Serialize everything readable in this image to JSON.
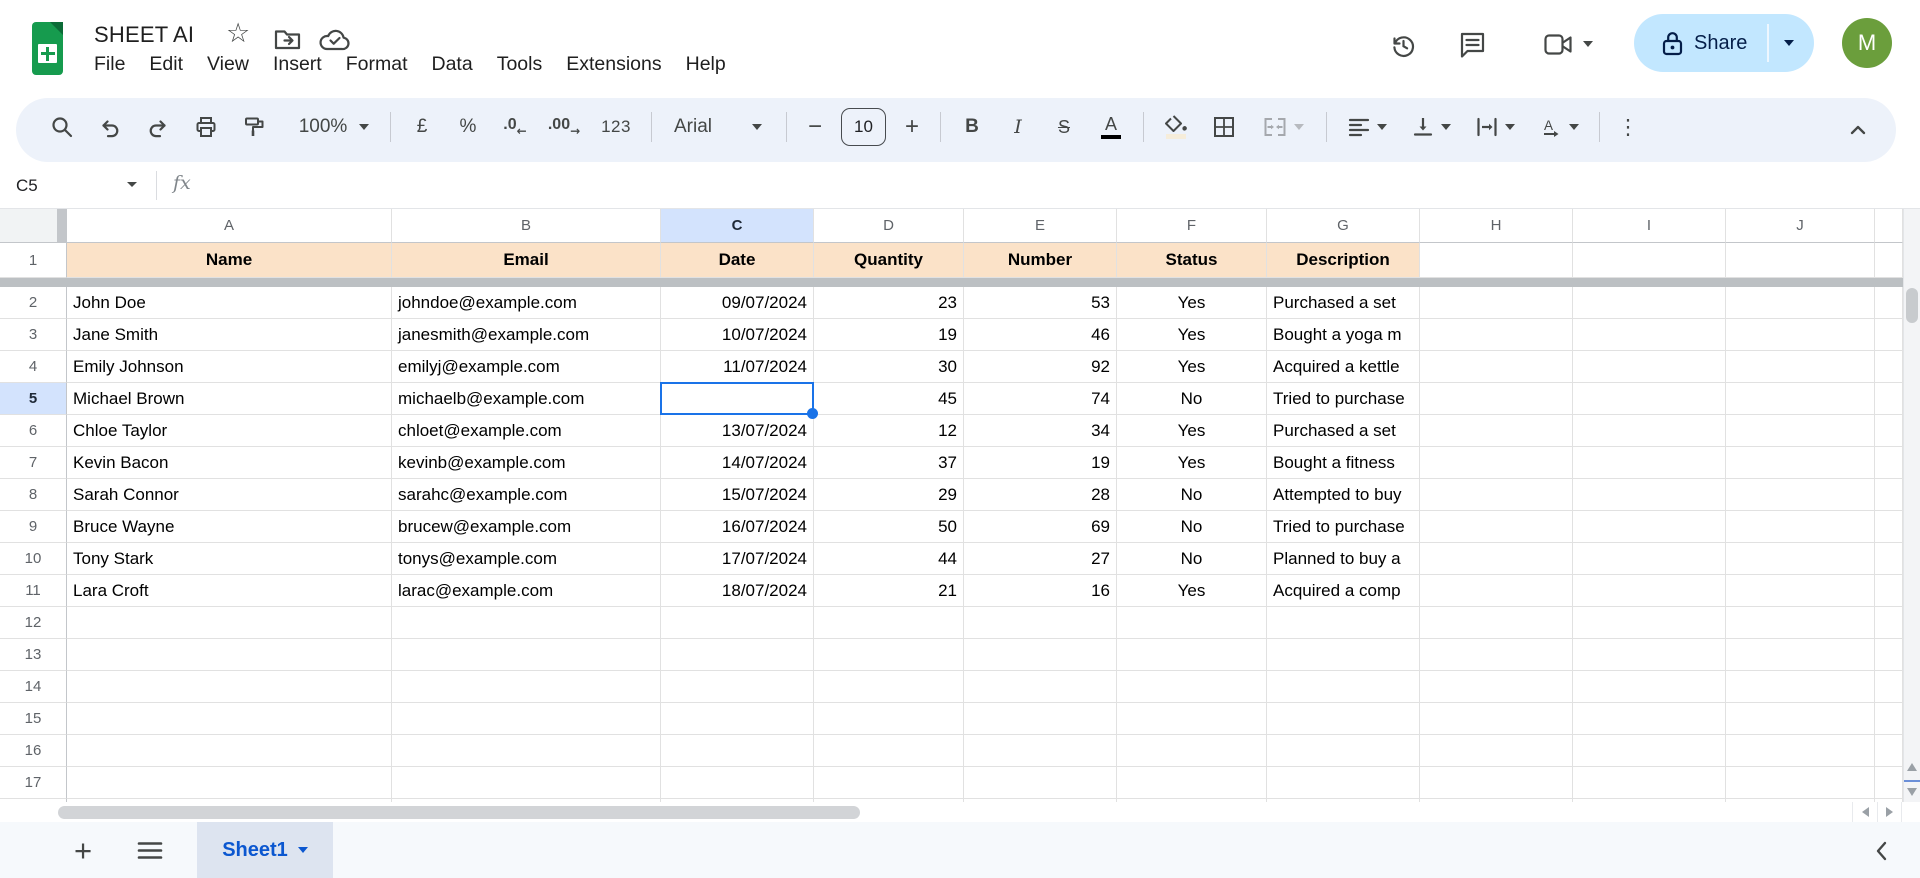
{
  "header": {
    "title": "SHEET AI",
    "menu_items": [
      "File",
      "Edit",
      "View",
      "Insert",
      "Format",
      "Data",
      "Tools",
      "Extensions",
      "Help"
    ],
    "share_label": "Share",
    "avatar_initial": "M"
  },
  "toolbar": {
    "zoom": "100%",
    "currency": "£",
    "percent": "%",
    "decimal_decrease": ".0",
    "decimal_increase": ".00",
    "format_123": "123",
    "font_family": "Arial",
    "font_size": "10",
    "bold": "B",
    "italic": "I",
    "strikethrough": "S",
    "text_color": "A",
    "more": "⋮"
  },
  "formula_bar": {
    "cell_reference": "C5",
    "fx": "fx"
  },
  "grid": {
    "column_letters": [
      "A",
      "B",
      "C",
      "D",
      "E",
      "F",
      "G",
      "H",
      "I",
      "J"
    ],
    "selected_column": "C",
    "selected_cell": "C5",
    "selected_row_number": 5,
    "header_row": [
      "Name",
      "Email",
      "Date",
      "Quantity",
      "Number",
      "Status",
      "Description"
    ],
    "rows": [
      {
        "n": 2,
        "name": "John Doe",
        "email": "johndoe@example.com",
        "date": "09/07/2024",
        "quantity": "23",
        "number": "53",
        "status": "Yes",
        "description": "Purchased a set"
      },
      {
        "n": 3,
        "name": "Jane Smith",
        "email": "janesmith@example.com",
        "date": "10/07/2024",
        "quantity": "19",
        "number": "46",
        "status": "Yes",
        "description": "Bought a yoga m"
      },
      {
        "n": 4,
        "name": "Emily Johnson",
        "email": "emilyj@example.com",
        "date": "11/07/2024",
        "quantity": "30",
        "number": "92",
        "status": "Yes",
        "description": "Acquired a kettle"
      },
      {
        "n": 5,
        "name": "Michael Brown",
        "email": "michaelb@example.com",
        "date": "",
        "quantity": "45",
        "number": "74",
        "status": "No",
        "description": "Tried to purchase"
      },
      {
        "n": 6,
        "name": "Chloe Taylor",
        "email": "chloet@example.com",
        "date": "13/07/2024",
        "quantity": "12",
        "number": "34",
        "status": "Yes",
        "description": "Purchased a set"
      },
      {
        "n": 7,
        "name": "Kevin Bacon",
        "email": "kevinb@example.com",
        "date": "14/07/2024",
        "quantity": "37",
        "number": "19",
        "status": "Yes",
        "description": "Bought a fitness"
      },
      {
        "n": 8,
        "name": "Sarah Connor",
        "email": "sarahc@example.com",
        "date": "15/07/2024",
        "quantity": "29",
        "number": "28",
        "status": "No",
        "description": "Attempted to buy"
      },
      {
        "n": 9,
        "name": "Bruce Wayne",
        "email": "brucew@example.com",
        "date": "16/07/2024",
        "quantity": "50",
        "number": "69",
        "status": "No",
        "description": "Tried to purchase"
      },
      {
        "n": 10,
        "name": "Tony Stark",
        "email": "tonys@example.com",
        "date": "17/07/2024",
        "quantity": "44",
        "number": "27",
        "status": "No",
        "description": "Planned to buy a"
      },
      {
        "n": 11,
        "name": "Lara Croft",
        "email": "larac@example.com",
        "date": "18/07/2024",
        "quantity": "21",
        "number": "16",
        "status": "Yes",
        "description": "Acquired a comp"
      }
    ],
    "empty_rows": [
      12,
      13,
      14,
      15,
      16,
      17
    ]
  },
  "sheet_bar": {
    "active_tab": "Sheet1"
  },
  "colors": {
    "header_fill": "#fbe2c8",
    "selection_blue": "#1a73e8",
    "selected_header_fill": "#d3e3fd",
    "share_pill": "#c2e7ff",
    "avatar_green": "#6b9e3c",
    "logo_green": "#169b4e",
    "active_tab_fill": "#dde4f0",
    "active_tab_text": "#0b57d0",
    "toolbar_bg": "#edf2fa"
  }
}
